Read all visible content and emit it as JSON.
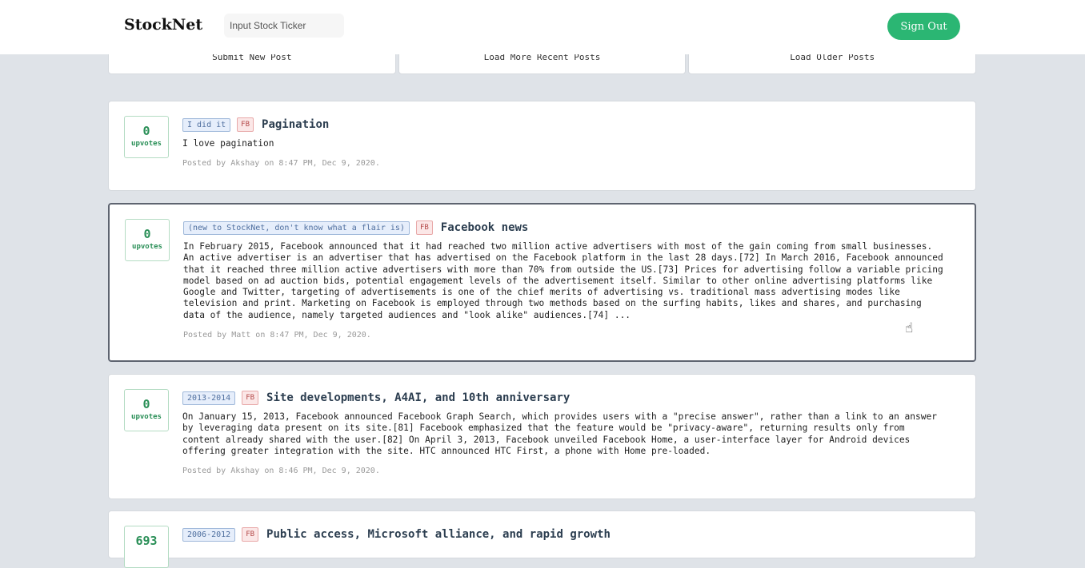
{
  "header": {
    "logo": "StockNet",
    "search_placeholder": "Input Stock Ticker",
    "sign_out_label": "Sign Out"
  },
  "toolbar": {
    "submit_label": "Submit New Post",
    "load_recent_label": "Load More Recent Posts",
    "load_older_label": "Load Older Posts"
  },
  "colors": {
    "accent_green": "#2bb673",
    "flair_blue": "#e6eefb",
    "ticker_red": "#fbe7e7",
    "background": "#dfe3e8"
  },
  "posts": [
    {
      "upvotes": "0",
      "upvotes_label": "upvotes",
      "flair": "I did it",
      "ticker": "FB",
      "title": "Pagination",
      "body": "I love pagination",
      "meta": "Posted by Akshay on 8:47 PM, Dec 9, 2020."
    },
    {
      "upvotes": "0",
      "upvotes_label": "upvotes",
      "flair": "(new to StockNet, don't know what a flair is)",
      "ticker": "FB",
      "title": "Facebook news",
      "body": "In February 2015, Facebook announced that it had reached two million active advertisers with most of the gain coming from small businesses.\nAn active advertiser is an advertiser that has advertised on the Facebook platform in the last 28 days.[72] In March 2016, Facebook announced\nthat it reached three million active advertisers with more than 70% from outside the US.[73] Prices for advertising follow a variable pricing\nmodel based on ad auction bids, potential engagement levels of the advertisement itself. Similar to other online advertising platforms like\nGoogle and Twitter, targeting of advertisements is one of the chief merits of advertising vs. traditional mass advertising modes like\ntelevision and print. Marketing on Facebook is employed through two methods based on the surfing habits, likes and shares, and purchasing\ndata of the audience, namely targeted audiences and \"look alike\" audiences.[74] ...",
      "meta": "Posted by Matt on 8:47 PM, Dec 9, 2020."
    },
    {
      "upvotes": "0",
      "upvotes_label": "upvotes",
      "flair": "2013-2014",
      "ticker": "FB",
      "title": "Site developments, A4AI, and 10th anniversary",
      "body": "On January 15, 2013, Facebook announced Facebook Graph Search, which provides users with a \"precise answer\", rather than a link to an answer\nby leveraging data present on its site.[81] Facebook emphasized that the feature would be \"privacy-aware\", returning results only from\ncontent already shared with the user.[82] On April 3, 2013, Facebook unveiled Facebook Home, a user-interface layer for Android devices\noffering greater integration with the site. HTC announced HTC First, a phone with Home pre-loaded.",
      "meta": "Posted by Akshay on 8:46 PM, Dec 9, 2020."
    },
    {
      "upvotes": "693",
      "flair": "2006-2012",
      "ticker": "FB",
      "title": "Public access, Microsoft alliance, and rapid growth"
    }
  ]
}
